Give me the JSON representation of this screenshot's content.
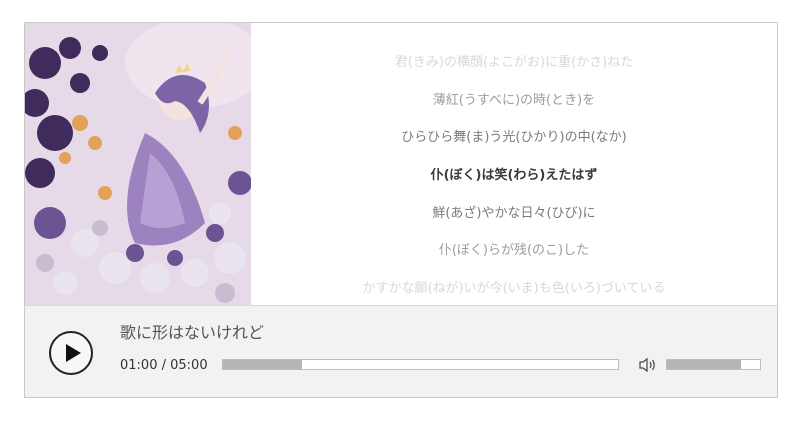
{
  "player": {
    "song_title": "歌に形はないけれど",
    "current_time": "01:00",
    "separator": " / ",
    "total_time": "05:00",
    "progress_fraction": 0.2,
    "volume_fraction": 0.8
  },
  "lyrics": [
    {
      "text": "君(きみ)の横顔(よこがお)に重(かさ)ねた",
      "style": "faint"
    },
    {
      "text": "薄紅(うすべに)の時(とき)を",
      "style": "light"
    },
    {
      "text": "ひらひら舞(ま)う光(ひかり)の中(なか)",
      "style": "normal"
    },
    {
      "text": "仆(ぼく)は笑(わら)えたはず",
      "style": "active"
    },
    {
      "text": "鮮(あざ)やかな日々(ひび)に",
      "style": "normal"
    },
    {
      "text": "仆(ぼく)らが残(のこ)した",
      "style": "light"
    },
    {
      "text": "かすかな願(ねが)いが今(いま)も色(いろ)づいている",
      "style": "faint"
    }
  ],
  "icons": {
    "play": "play-icon",
    "volume": "speaker-icon"
  },
  "colors": {
    "control_bar": "#f2f2f2",
    "progress_fill": "#b5b5b5",
    "active_lyric": "#3a3a3a"
  }
}
